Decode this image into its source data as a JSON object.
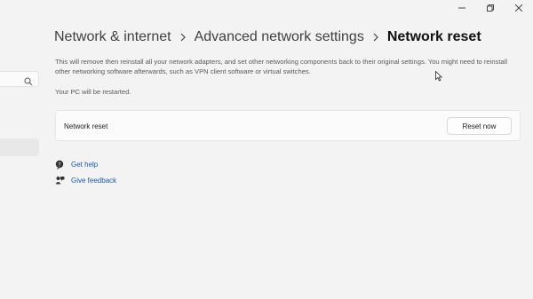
{
  "window": {
    "controls": [
      "minimize",
      "maximize",
      "close"
    ]
  },
  "sidebar": {
    "search_icon": "search-icon"
  },
  "breadcrumb": {
    "items": [
      "Network & internet",
      "Advanced network settings"
    ],
    "current": "Network reset",
    "separator_icon": "chevron-right-icon"
  },
  "content": {
    "description": "This will remove then reinstall all your network adapters, and set other networking components back to their original settings. You might need to reinstall other networking software afterwards, such as VPN client software or virtual switches.",
    "restart_note": "Your PC will be restarted.",
    "card": {
      "label": "Network reset",
      "button_label": "Reset now"
    }
  },
  "links": {
    "help": {
      "label": "Get help",
      "icon": "help-chat-icon"
    },
    "feedback": {
      "label": "Give feedback",
      "icon": "feedback-icon"
    }
  },
  "colors": {
    "background": "#f3f3f3",
    "card": "#fbfbfb",
    "link": "#1a5aa6"
  }
}
